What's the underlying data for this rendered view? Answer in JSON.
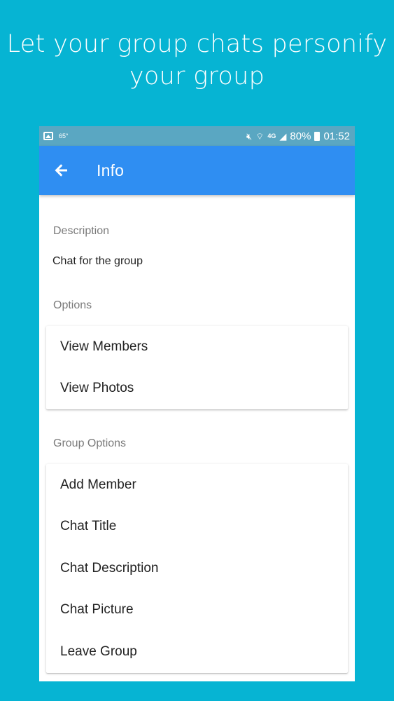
{
  "promo": {
    "line1": "Let your group chats personify",
    "line2": "your group"
  },
  "status_bar": {
    "temperature": "65°",
    "network": "4G",
    "battery": "80%",
    "time": "01:52",
    "icons": [
      "gallery-icon",
      "mute-icon",
      "wifi-icon",
      "signal-icon",
      "battery-icon"
    ]
  },
  "app_bar": {
    "title": "Info",
    "back_icon": "arrow-left-icon"
  },
  "description": {
    "label": "Description",
    "text": "Chat for the group"
  },
  "options": {
    "label": "Options",
    "items": [
      "View Members",
      "View Photos"
    ]
  },
  "group_options": {
    "label": "Group Options",
    "items": [
      "Add Member",
      "Chat Title",
      "Chat Description",
      "Chat Picture",
      "Leave Group"
    ]
  },
  "colors": {
    "background": "#06b4d3",
    "status_bar": "#5aa7c2",
    "app_bar": "#2f8ef2"
  }
}
